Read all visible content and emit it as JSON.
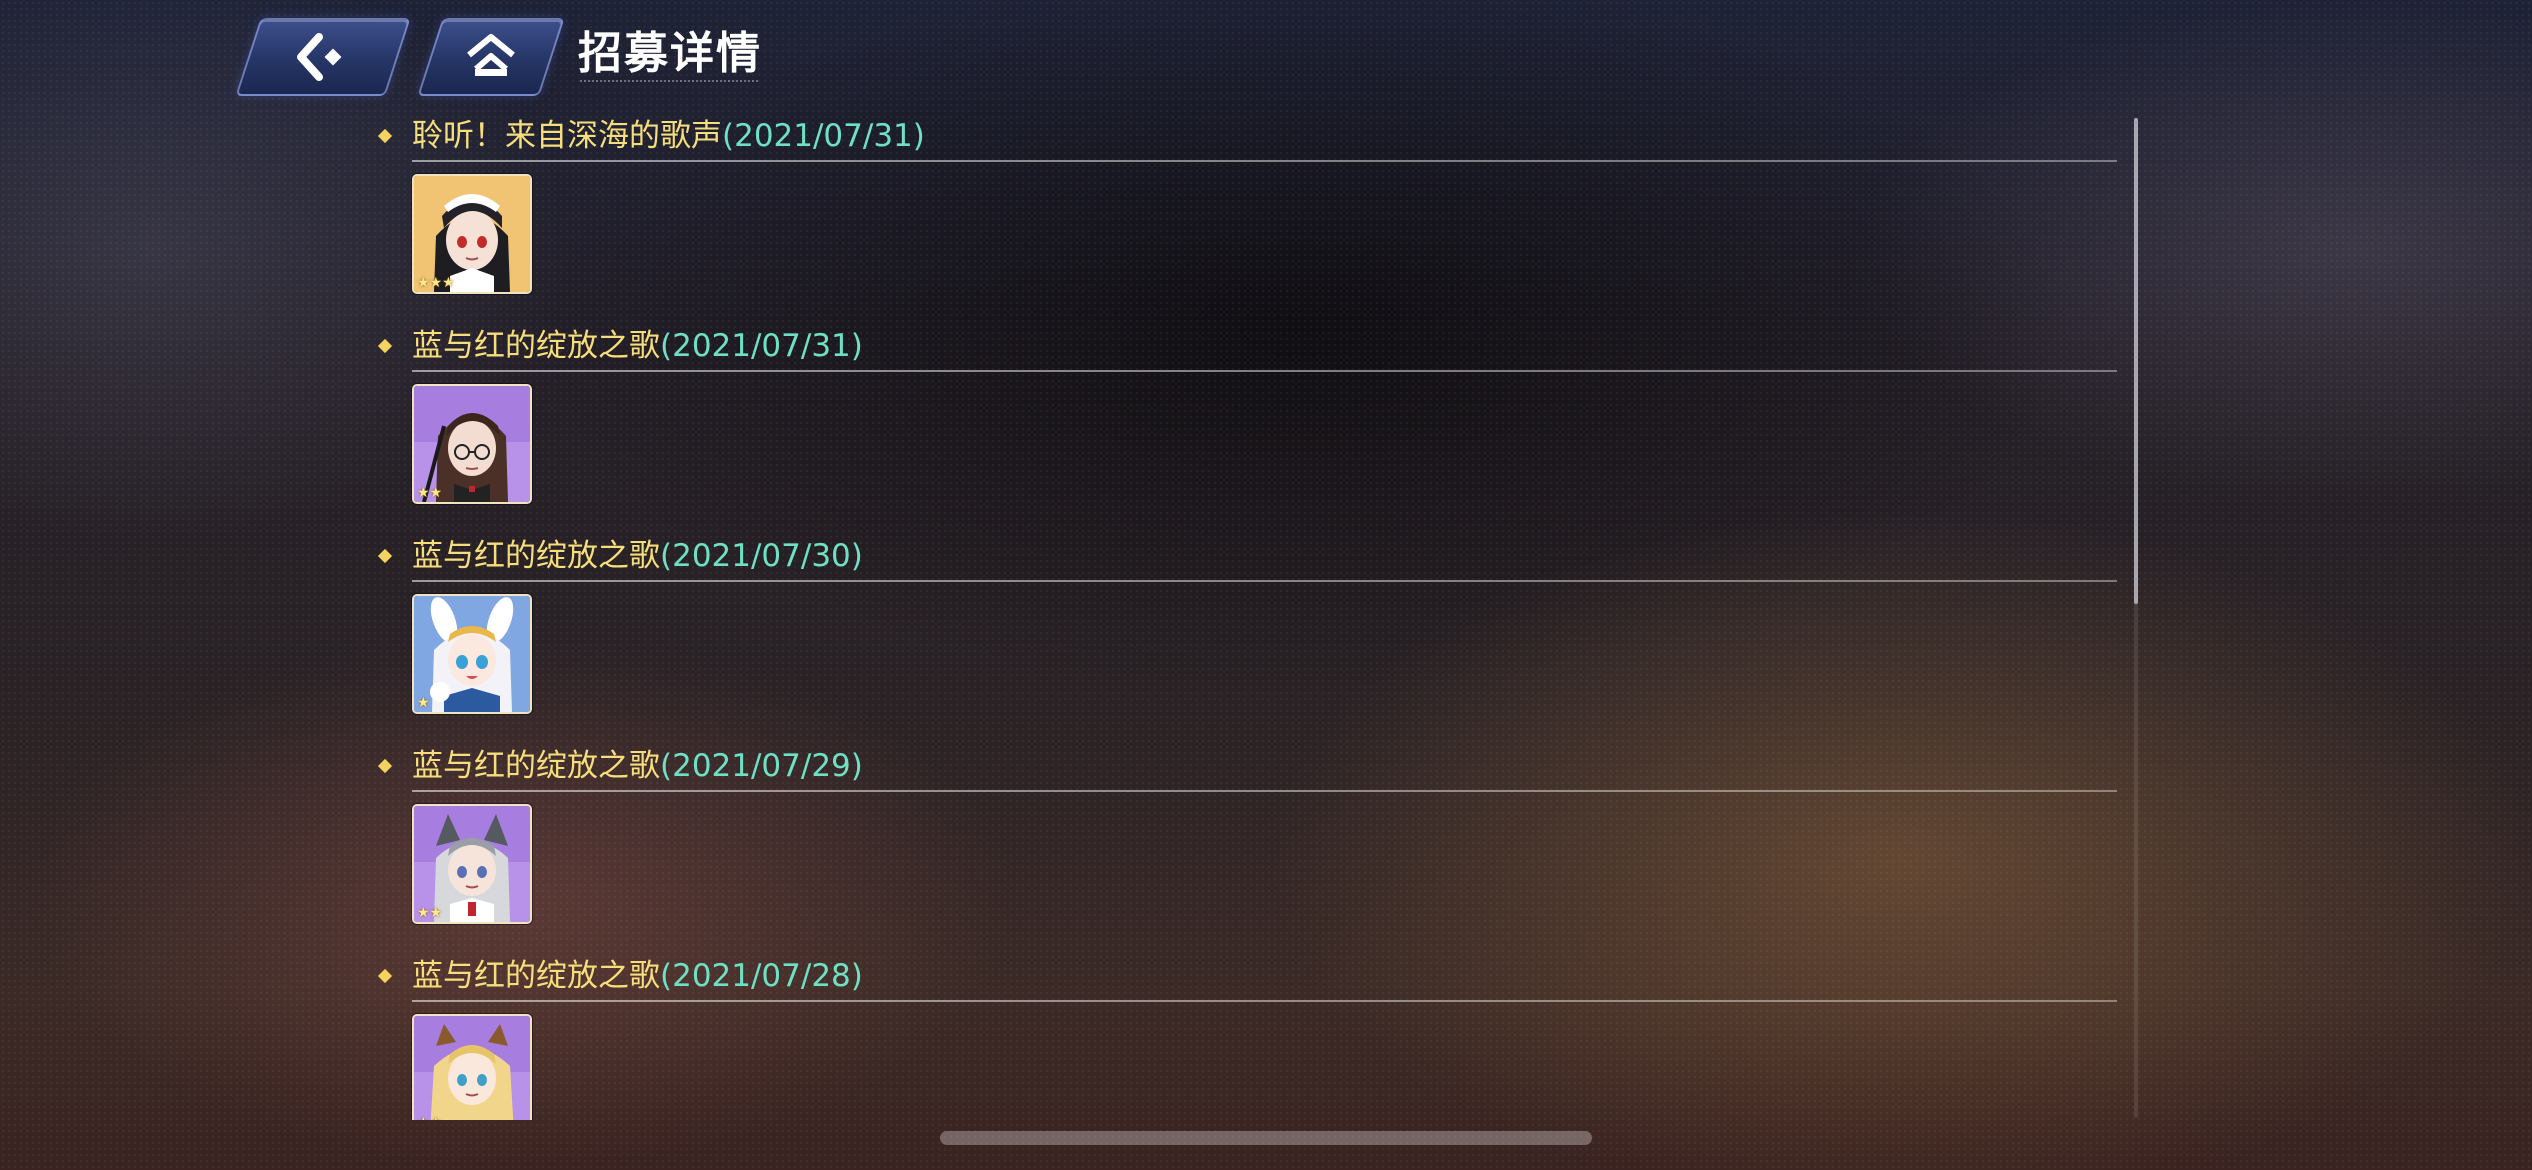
{
  "header": {
    "title": "招募详情",
    "back_icon": "back-arrow-icon",
    "home_icon": "home-icon"
  },
  "entries": [
    {
      "name": "聆听！来自深海的歌声",
      "date": "(2021/07/31)",
      "portrait": "maid-character-portrait",
      "stars": "★★★",
      "frame_color": "#e8b65a"
    },
    {
      "name": "蓝与红的绽放之歌",
      "date": "(2021/07/31)",
      "portrait": "glasses-character-portrait",
      "stars": "★★",
      "frame_color": "#a77de0"
    },
    {
      "name": "蓝与红的绽放之歌",
      "date": "(2021/07/30)",
      "portrait": "bunny-ear-character-portrait",
      "stars": "★",
      "frame_color": "#5f8fd6"
    },
    {
      "name": "蓝与红的绽放之歌",
      "date": "(2021/07/29)",
      "portrait": "wolf-ear-character-portrait",
      "stars": "★★",
      "frame_color": "#a77de0"
    },
    {
      "name": "蓝与红的绽放之歌",
      "date": "(2021/07/28)",
      "portrait": "blonde-character-portrait",
      "stars": "★★",
      "frame_color": "#a77de0"
    }
  ],
  "scroll": {
    "position_fraction": 0.0
  },
  "colors": {
    "entry_name": "#f6de7c",
    "entry_date": "#6ee0c4",
    "bullet": "#f4d35e"
  }
}
